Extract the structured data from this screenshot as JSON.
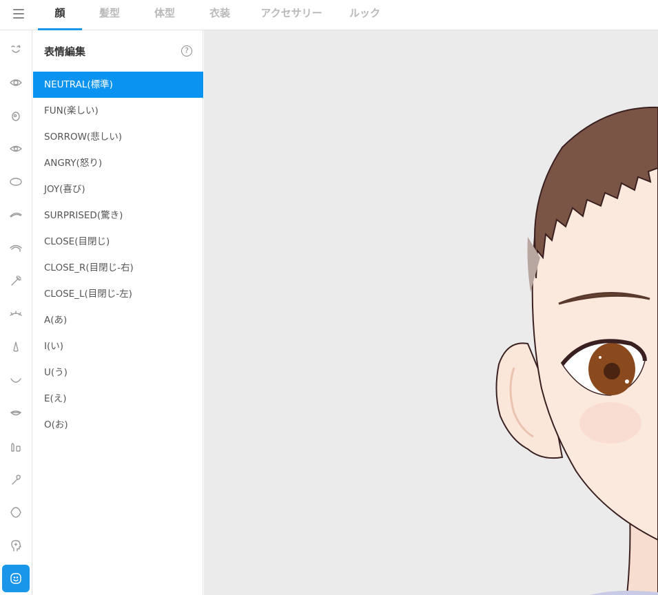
{
  "nav": {
    "menu_icon": "hamburger-icon",
    "tabs": [
      {
        "label": "顔",
        "active": true
      },
      {
        "label": "髪型",
        "active": false
      },
      {
        "label": "体型",
        "active": false
      },
      {
        "label": "衣装",
        "active": false
      },
      {
        "label": "アクセサリー",
        "active": false
      },
      {
        "label": "ルック",
        "active": false
      }
    ]
  },
  "rail": {
    "icons": [
      "face-shape-icon",
      "eye-icon",
      "iris-icon",
      "eye-highlight-icon",
      "eye-white-icon",
      "eyebrow-icon",
      "eyelash-icon",
      "eyeliner-icon",
      "eye-shape-icon",
      "nose-icon",
      "mouth-icon",
      "lips-icon",
      "teeth-icon",
      "ear-icon",
      "head-shape-icon",
      "head-profile-icon",
      "expression-icon"
    ],
    "active_icon": "expression-icon"
  },
  "panel": {
    "title": "表情編集",
    "help_glyph": "?",
    "expressions": [
      "NEUTRAL(標準)",
      "FUN(楽しい)",
      "SORROW(悲しい)",
      "ANGRY(怒り)",
      "JOY(喜び)",
      "SURPRISED(驚き)",
      "CLOSE(目閉じ)",
      "CLOSE_R(目閉じ-右)",
      "CLOSE_L(目閉じ-左)",
      "A(あ)",
      "I(い)",
      "U(う)",
      "E(え)",
      "O(お)"
    ],
    "selected_index": 0
  },
  "colors": {
    "accent": "#1a96e8",
    "selected_row": "#0a93f0",
    "viewport_bg": "#ebebeb",
    "hair": "#7a5545",
    "skin": "#fbe9dd",
    "iris": "#8a4a1e"
  }
}
